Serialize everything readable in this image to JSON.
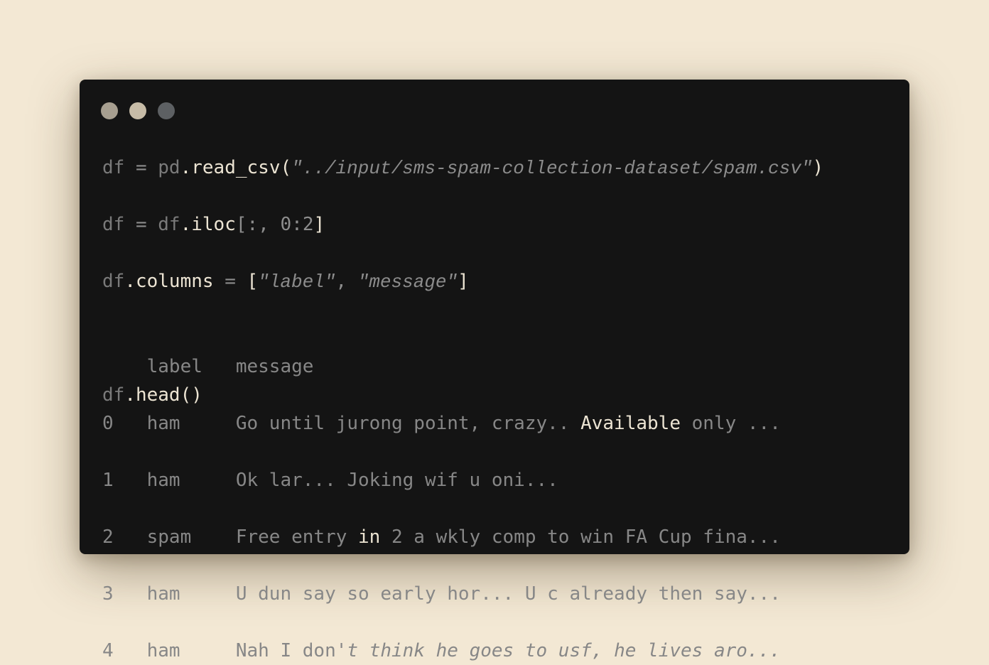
{
  "code": {
    "line1": {
      "var": "df",
      "eq": " = ",
      "mod": "pd",
      "dot": ".",
      "fn": "read_csv",
      "open": "(",
      "string": "\"../input/sms-spam-collection-dataset/spam.csv\"",
      "close": ")"
    },
    "line2": {
      "var": "df",
      "eq": " = ",
      "obj": "df",
      "dot": ".",
      "fn": "iloc",
      "open": "[:, ",
      "num1": "0",
      "colon": ":",
      "num2": "2",
      "close": "]"
    },
    "line3": {
      "obj": "df",
      "dot": ".",
      "fn": "columns",
      "eq": " = ",
      "open": "[",
      "str1": "\"label\"",
      "comma": ", ",
      "str2": "\"message\"",
      "close": "]"
    },
    "line4": {
      "obj": "df",
      "dot": ".",
      "fn": "head",
      "parens": "()"
    }
  },
  "output": {
    "header": "    label   message",
    "rows": [
      {
        "a": "0   ham     Go until jurong point, crazy.. ",
        "b": "Available",
        "c": " only ..."
      },
      {
        "a": "1   ham     Ok lar... Joking wif u oni..."
      },
      {
        "a": "2   spam    Free entry ",
        "b": "in",
        "c": " 2 a wkly comp to win FA Cup fina..."
      },
      {
        "a": "3   ham     U dun say so early hor... U c already then say..."
      },
      {
        "a": "4   ham     Nah I don",
        "b": "'t think he goes to usf, he lives aro..."
      }
    ]
  }
}
